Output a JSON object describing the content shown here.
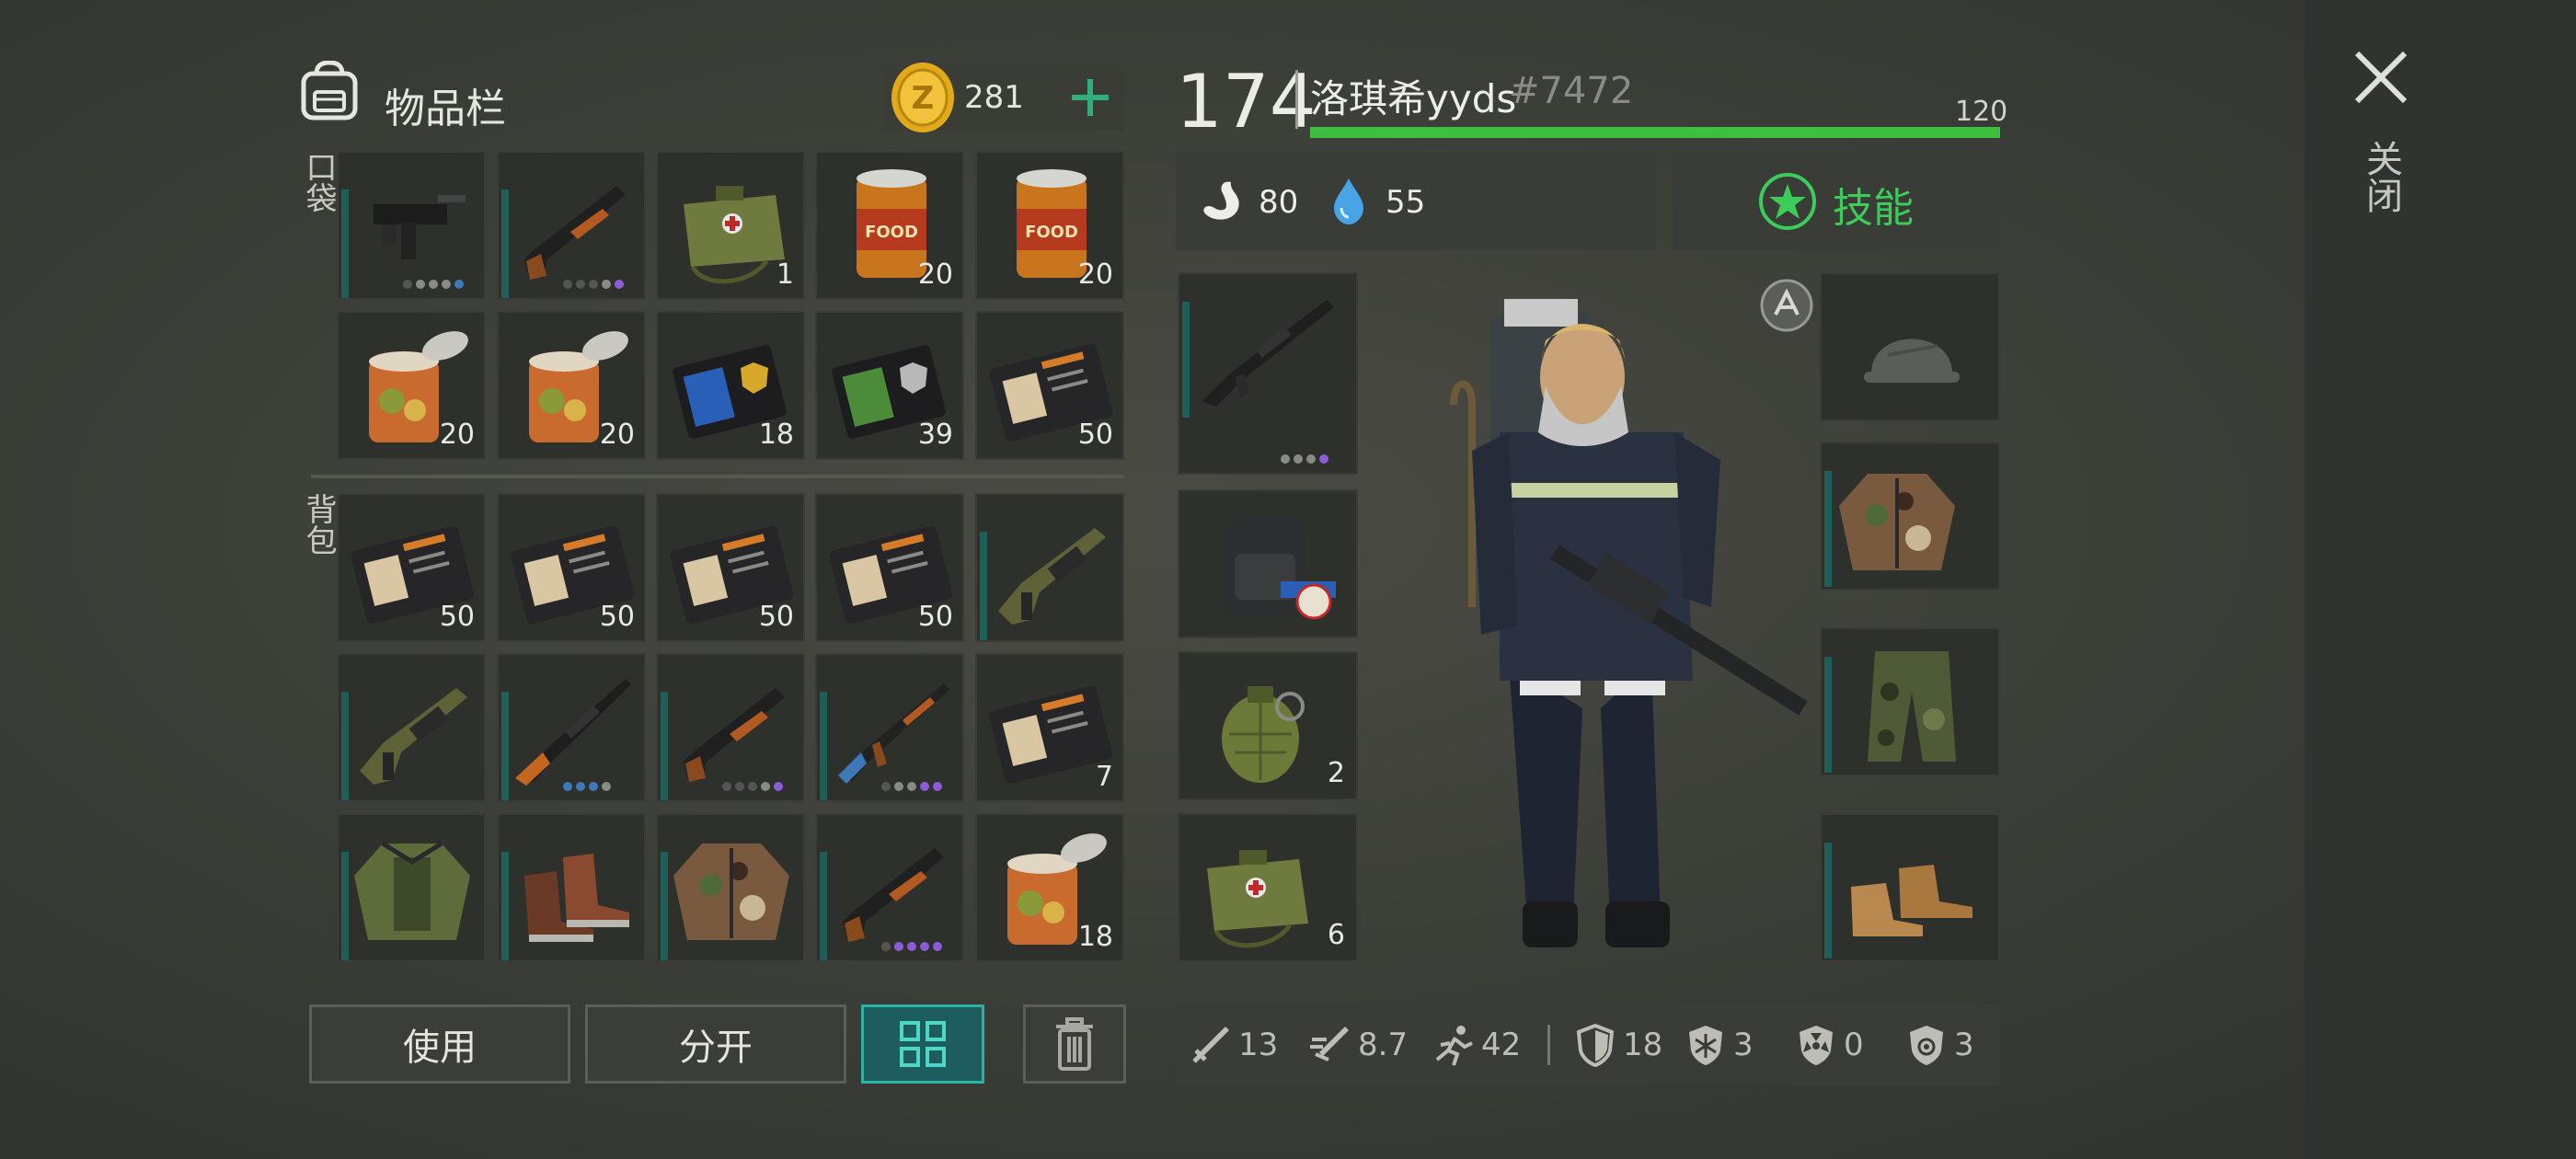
{
  "header": {
    "title": "物品栏",
    "coins": "281",
    "add_icon": "plus-icon",
    "bag_icon": "backpack-icon"
  },
  "sections": {
    "pocket": "口袋",
    "backpack": "背包"
  },
  "pocket_items": [
    {
      "name": "uzi",
      "count": "",
      "dots": [
        "d",
        "n",
        "n",
        "n",
        "b"
      ]
    },
    {
      "name": "shotgun",
      "count": "",
      "dots": [
        "d",
        "d",
        "d",
        "n",
        "p"
      ]
    },
    {
      "name": "medkit-bag",
      "count": "1",
      "dots": []
    },
    {
      "name": "food-can",
      "count": "20",
      "dots": []
    },
    {
      "name": "food-can",
      "count": "20",
      "dots": []
    },
    {
      "name": "open-can",
      "count": "20",
      "dots": []
    },
    {
      "name": "open-can",
      "count": "20",
      "dots": []
    },
    {
      "name": "police-badge-blue",
      "count": "18",
      "dots": []
    },
    {
      "name": "police-badge-green",
      "count": "39",
      "dots": []
    },
    {
      "name": "patrol-id",
      "count": "50",
      "dots": []
    }
  ],
  "backpack_items": [
    {
      "name": "patrol-id",
      "count": "50",
      "dots": []
    },
    {
      "name": "patrol-id",
      "count": "50",
      "dots": []
    },
    {
      "name": "patrol-id",
      "count": "50",
      "dots": []
    },
    {
      "name": "patrol-id",
      "count": "50",
      "dots": []
    },
    {
      "name": "grenade-launcher",
      "count": "",
      "dots": []
    },
    {
      "name": "grenade-launcher",
      "count": "",
      "dots": []
    },
    {
      "name": "sniper-rifle",
      "count": "",
      "dots": [
        "b",
        "b",
        "b",
        "n"
      ]
    },
    {
      "name": "shotgun",
      "count": "",
      "dots": [
        "d",
        "d",
        "d",
        "n",
        "p"
      ]
    },
    {
      "name": "ak-rifle",
      "count": "",
      "dots": [
        "d",
        "n",
        "n",
        "p",
        "p"
      ]
    },
    {
      "name": "patrol-id",
      "count": "7",
      "dots": []
    },
    {
      "name": "green-jacket",
      "count": "",
      "dots": []
    },
    {
      "name": "brown-boots",
      "count": "",
      "dots": []
    },
    {
      "name": "camo-jacket",
      "count": "",
      "dots": []
    },
    {
      "name": "shotgun",
      "count": "",
      "dots": [
        "d",
        "p",
        "p",
        "p",
        "p"
      ]
    },
    {
      "name": "open-can",
      "count": "18",
      "dots": []
    }
  ],
  "buttons": {
    "use": "使用",
    "split": "分开",
    "grid_icon": "grid-icon",
    "trash_icon": "trash-icon"
  },
  "player": {
    "level": "174",
    "name": "洛琪希yyds",
    "tag": "#7472",
    "hp": "120",
    "hp_fraction": 1.0
  },
  "status": {
    "hunger": "80",
    "thirst": "55",
    "skills": "技能"
  },
  "equip_left": [
    {
      "name": "m16-rifle",
      "count": ""
    },
    {
      "name": "paris-backpack",
      "count": ""
    },
    {
      "name": "frag-grenade",
      "count": "2"
    },
    {
      "name": "medkit-bag",
      "count": "6"
    }
  ],
  "equip_right": [
    {
      "name": "helmet-slot-empty"
    },
    {
      "name": "camo-jacket"
    },
    {
      "name": "camo-pants"
    },
    {
      "name": "leather-shoes"
    }
  ],
  "stats": {
    "damage": "13",
    "attack_speed": "8.7",
    "speed": "42",
    "armor": "18",
    "cold": "3",
    "radiation": "0",
    "bio": "3"
  },
  "close": {
    "label": "关闭"
  },
  "colors": {
    "accent_teal": "#2bb3a3",
    "hp_green": "#3fbf3f",
    "skill_green": "#3dcb5a",
    "coin_gold": "#e2a91a"
  }
}
